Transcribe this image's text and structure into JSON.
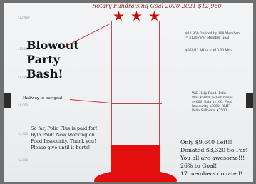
{
  "title": "Rotary Fundraising Goal 2020-2021  $12,960",
  "y_ticks": [
    "$12,960",
    "$10,000",
    "$8,000",
    "$6,000",
    "$4,000",
    "$2,000"
  ],
  "headline": [
    "Blowout",
    "Party",
    "Bash!"
  ],
  "halfway_label": "Halfway to our goal!",
  "progress_note": [
    "So far, Polio Plus is paid for!",
    "Ryla Paid! Now working on",
    "Food Insecurity.  Thank you!",
    "Please give until it hurts!"
  ],
  "goal_calc": [
    "$12,960 Divided by 108 Members",
    "= $120 / Per Member Goal"
  ],
  "goal_monthly": "$960/12 Mths = $10.00 Mth!",
  "allocations": [
    "Will Help Fund:  Polio",
    "Plus $5000, Scholarships",
    "$4000, Ryla $1100, Food",
    "Insecurity $3060, RMF",
    "Polio Software $7500"
  ],
  "status": [
    "Only $9,640 Left!!",
    "Donated $3,320 So Far!",
    "You all are awesome!!!",
    "26% to Goal!",
    "17 members donated!"
  ],
  "progress": {
    "raised": 3320,
    "goal": 12960,
    "percent": 26
  },
  "colors": {
    "fill": "#e30f0f",
    "stars": "#c70d0d",
    "title": "#8a2b2b"
  }
}
